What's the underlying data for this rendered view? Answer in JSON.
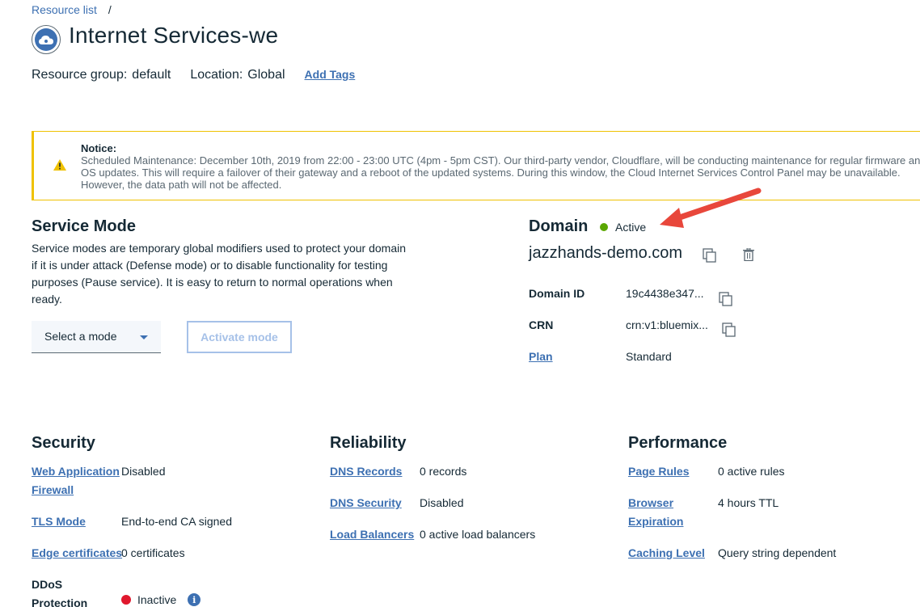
{
  "breadcrumb": {
    "root": "Resource list",
    "separator": "/"
  },
  "header": {
    "title": "Internet Services-we",
    "icon": "cloud-services-icon",
    "resource_group_label": "Resource group:",
    "resource_group_value": "default",
    "location_label": "Location:",
    "location_value": "Global",
    "add_tags": "Add Tags"
  },
  "notice": {
    "title": "Notice:",
    "body": "Scheduled Maintenance: December 10th, 2019 from 22:00 - 23:00 UTC (4pm - 5pm CST). Our third-party vendor, Cloudflare, will be conducting maintenance for regular firmware and OS updates. This will require a failover of their gateway and a reboot of the updated systems. During this window, the Cloud Internet Services Control Panel may be unavailable. However, the data path will not be affected.",
    "icon": "warning-icon",
    "color": "#efc100"
  },
  "service_mode": {
    "title": "Service Mode",
    "description": "Service modes are temporary global modifiers used to protect your domain if it is under attack (Defense mode) or to disable functionality for testing purposes (Pause service). It is easy to return to normal operations when ready.",
    "select_placeholder": "Select a mode",
    "activate_label": "Activate mode"
  },
  "domain": {
    "title": "Domain",
    "status": "Active",
    "status_color": "#5aa700",
    "name": "jazzhands-demo.com",
    "id_label": "Domain ID",
    "id_value": "19c4438e347...",
    "crn_label": "CRN",
    "crn_value": "crn:v1:bluemix...",
    "plan_label": "Plan",
    "plan_value": "Standard"
  },
  "security": {
    "title": "Security",
    "waf_label_1": "Web Application",
    "waf_label_2": "Firewall",
    "waf_value": "Disabled",
    "tls_label": "TLS Mode",
    "tls_value": "End-to-end CA signed",
    "edge_label": "Edge certificates",
    "edge_value": "0 certificates",
    "ddos_label_1": "DDoS",
    "ddos_label_2": "Protection",
    "ddos_value": "Inactive",
    "ddos_color": "#e0182d"
  },
  "reliability": {
    "title": "Reliability",
    "dns_records_label": "DNS Records",
    "dns_records_value": "0 records",
    "dns_security_label": "DNS Security",
    "dns_security_value": "Disabled",
    "lb_label": "Load Balancers",
    "lb_value": "0 active load balancers"
  },
  "performance": {
    "title": "Performance",
    "page_rules_label": "Page Rules",
    "page_rules_value": "0 active rules",
    "browser_label_1": "Browser",
    "browser_label_2": "Expiration",
    "browser_value": "4 hours TTL",
    "caching_label": "Caching Level",
    "caching_value": "Query string dependent"
  },
  "colors": {
    "link": "#3d70b2",
    "arrow": "#e8473b"
  }
}
